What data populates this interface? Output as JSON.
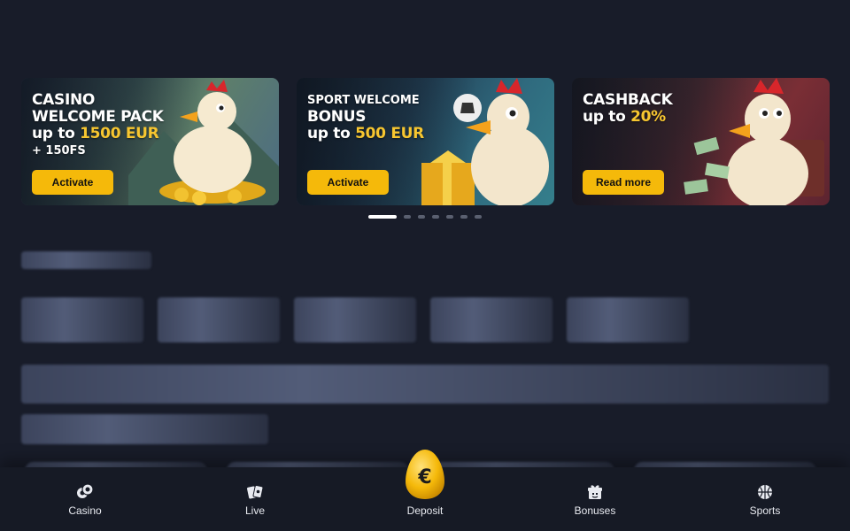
{
  "promos": [
    {
      "lines": [
        {
          "text": "CASINO",
          "size": "big"
        },
        {
          "text": "WELCOME PACK",
          "size": "big"
        },
        {
          "prefix": "up to ",
          "accent": "1500 EUR",
          "size": "big"
        },
        {
          "text": "+ 150FS",
          "size": "small"
        }
      ],
      "button": "Activate"
    },
    {
      "lines": [
        {
          "text": "SPORT WELCOME",
          "size": "small"
        },
        {
          "text": "BONUS",
          "size": "big"
        },
        {
          "prefix": "up to ",
          "accent": "500 EUR",
          "size": "big"
        }
      ],
      "button": "Activate"
    },
    {
      "lines": [
        {
          "text": "CASHBACK",
          "size": "big"
        },
        {
          "prefix": "up to ",
          "accent": "20%",
          "size": "big"
        }
      ],
      "button": "Read more"
    }
  ],
  "carousel": {
    "slide_count": 7,
    "active_index": 0
  },
  "nav": {
    "casino": "Casino",
    "live": "Live",
    "deposit": "Deposit",
    "bonuses": "Bonuses",
    "sports": "Sports"
  },
  "colors": {
    "background": "#181c29",
    "accent": "#f7c630",
    "button": "#f5b90a"
  },
  "icons": {
    "casino": "chips-icon",
    "live": "cards-icon",
    "deposit": "euro-egg-icon",
    "bonuses": "gift-icon",
    "sports": "basketball-icon"
  }
}
